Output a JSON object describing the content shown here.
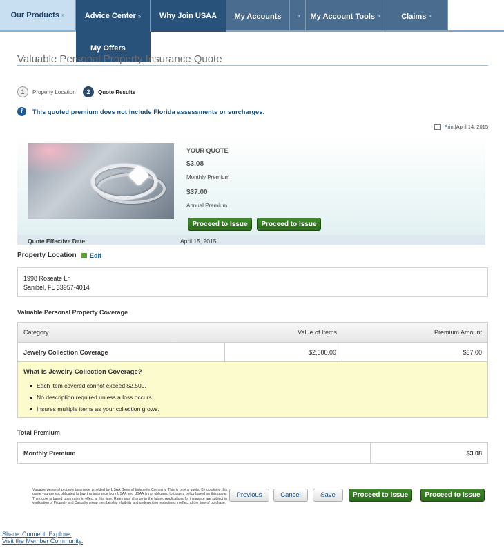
{
  "nav": {
    "our_products": "Our Products",
    "advice_center": "Advice Center",
    "why_join": "Why Join USAA",
    "my_accounts": "My Accounts",
    "account_tools": "My Account Tools",
    "claims": "Claims",
    "dropdown_item": "My Offers",
    "chevron": "»"
  },
  "page": {
    "title": "Valuable Personal Property Insurance Quote"
  },
  "steps": [
    {
      "num": "1",
      "label": "Property Location"
    },
    {
      "num": "2",
      "label": "Quote Results"
    }
  ],
  "notice": {
    "icon_glyph": "i",
    "text": "This quoted premium does not include Florida assessments or surcharges."
  },
  "print": {
    "link": "Print",
    "separator": " | ",
    "date": "April 14, 2015"
  },
  "quote": {
    "heading": "YOUR QUOTE",
    "monthly_amount": "$3.08",
    "monthly_label": "Monthly Premium",
    "annual_amount": "$37.00",
    "annual_label": "Annual Premium",
    "proceed_label": "Proceed to Issue",
    "effective_label": "Quote Effective Date",
    "effective_date": "April 15, 2015"
  },
  "property": {
    "heading": "Property Location",
    "edit": "Edit",
    "address_line1": "1998 Roseate Ln",
    "address_line2": "Sanibel, FL  33957-4014"
  },
  "coverage": {
    "heading": "Valuable Personal Property Coverage",
    "columns": [
      "Category",
      "Value of Items",
      "Premium Amount"
    ],
    "rows": [
      {
        "category": "Jewelry Collection Coverage",
        "value": "$2,500.00",
        "premium": "$37.00"
      }
    ],
    "what_title": "What is Jewelry Collection Coverage?",
    "bullets": [
      "Each item covered cannot exceed $2,500.",
      "No description required unless a loss occurs.",
      "Insures multiple items as your collection grows."
    ]
  },
  "total": {
    "heading": "Total Premium",
    "label": "Monthly Premium",
    "amount": "$3.08"
  },
  "footer": {
    "disclaimer": "Valuable personal property insurance provided by USAA General Indemnity Company. This is only a quote. By obtaining this quote you are not obligated to buy this insurance from USAA and USAA is not obligated to issue a policy based on this quote. The quote is based upon rates in effect at this time. Rates may change in the future. Applications for insurance are subject to verification of Property and Casualty group membership eligibility and underwriting restrictions in effect at the time of purchase.",
    "previous": "Previous",
    "cancel": "Cancel",
    "save": "Save",
    "proceed": "Proceed to Issue",
    "share_line1": "Share. Connect. Explore.",
    "share_line2": "Visit the Member Community."
  }
}
